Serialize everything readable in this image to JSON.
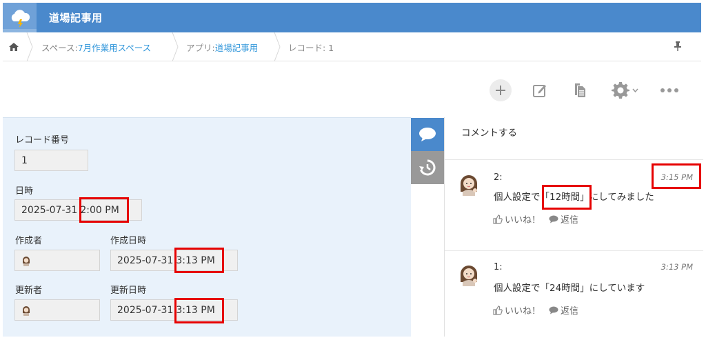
{
  "app": {
    "title": "道場記事用"
  },
  "breadcrumb": {
    "space_prefix": "スペース: ",
    "space_name": "7月作業用スペース",
    "app_prefix": "アプリ: ",
    "app_name": "道場記事用",
    "record": "レコード: 1"
  },
  "record": {
    "record_number_label": "レコード番号",
    "record_number_value": "1",
    "datetime_label": "日時",
    "datetime_date": "2025-07-31",
    "datetime_time": "2:00 PM",
    "creator_label": "作成者",
    "created_at_label": "作成日時",
    "created_at_date": "2025-07-31",
    "created_at_time": "3:13 PM",
    "updater_label": "更新者",
    "updated_at_label": "更新日時",
    "updated_at_date": "2025-07-31",
    "updated_at_time": "3:13 PM"
  },
  "comments": {
    "input_placeholder": "コメントする",
    "items": [
      {
        "number": "2:",
        "time": "3:15 PM",
        "text_before": "個人設定で",
        "text_highlight": "「12時間」",
        "text_after": "にしてみました",
        "like": "いいね！",
        "reply": "返信"
      },
      {
        "number": "1:",
        "time": "3:13 PM",
        "text": "個人設定で「24時間」にしています",
        "like": "いいね！",
        "reply": "返信"
      }
    ]
  },
  "colors": {
    "header_bg": "#4a89cc",
    "record_bg": "#e9f2fb",
    "tab_active": "#4a89cc",
    "tab_inactive": "#999999",
    "link": "#3498db",
    "highlight": "#e60000"
  }
}
